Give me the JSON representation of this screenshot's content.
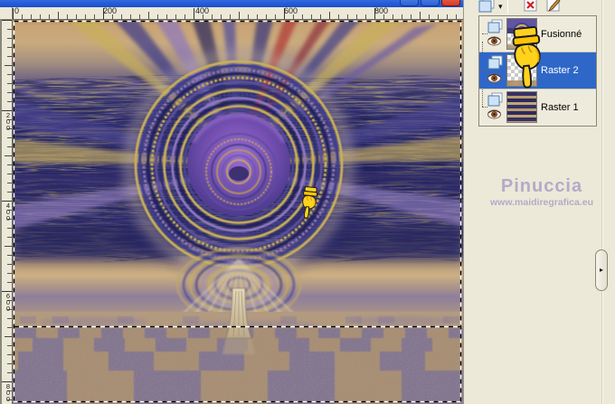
{
  "window": {
    "controls": [
      {
        "name": "minimize"
      },
      {
        "name": "maximize"
      },
      {
        "name": "close"
      }
    ]
  },
  "rulers": {
    "horizontal": [
      "0",
      "200",
      "400",
      "600",
      "800"
    ],
    "vertical": [
      "200",
      "400",
      "600",
      "800"
    ]
  },
  "canvas": {
    "description": "abstract artwork: concentric gold/purple circle, radial streaks, checkered sand floor, marching-ants selection",
    "selection_marquee": true
  },
  "layers_panel": {
    "toolbar": {
      "new_layer_icon": "new-layer-pages",
      "dropdown": "▾",
      "delete_layer_icon": "delete-layer-x",
      "edit_layer_icon": "edit-layer-pencil"
    },
    "layers": [
      {
        "name": "Fusionné",
        "selected": false,
        "visible": true
      },
      {
        "name": "Raster 2",
        "selected": true,
        "visible": true
      },
      {
        "name": "Raster 1",
        "selected": false,
        "visible": true
      }
    ],
    "pointer_icon": "yellow-glove-pointing-down",
    "watermark_name": "Pinuccia",
    "watermark_url": "www.maidiregrafica.eu",
    "scroll_arrow": "▸",
    "colors": {
      "selection_blue": "#2f67c8",
      "panel_bg": "#ece9d8",
      "titlebar_blue": "#2a5ad4"
    }
  }
}
